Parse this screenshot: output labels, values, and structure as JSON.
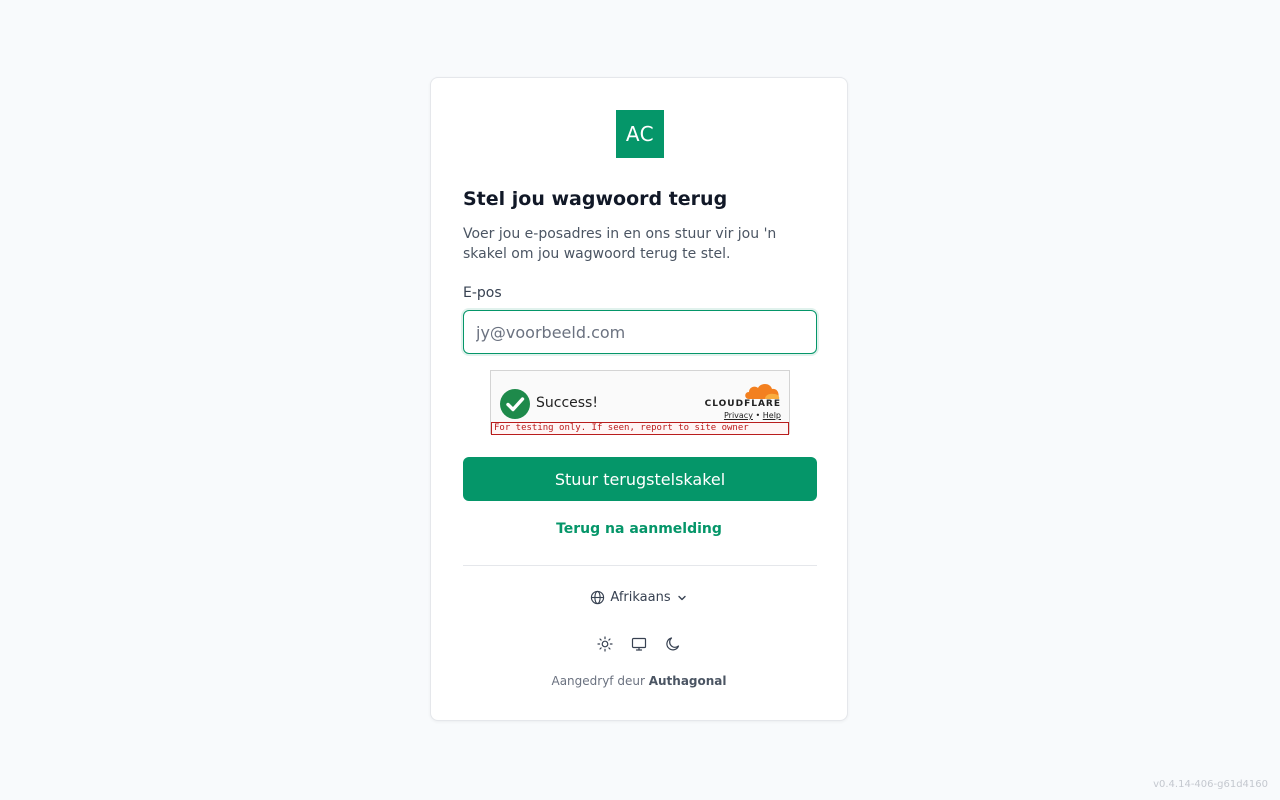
{
  "logo": {
    "text": "AC"
  },
  "page": {
    "title": "Stel jou wagwoord terug",
    "subtitle": "Voer jou e-posadres in en ons stuur vir jou 'n skakel om jou wagwoord terug te stel."
  },
  "form": {
    "email_label": "E-pos",
    "email_value": "",
    "email_placeholder": "jy@voorbeeld.com",
    "submit_label": "Stuur terugstelskakel"
  },
  "captcha": {
    "status_text": "Success!",
    "brand": "CLOUDFLARE",
    "privacy_label": "Privacy",
    "separator": "•",
    "help_label": "Help",
    "warning": "For testing only. If seen, report to site owner",
    "status_icon": "check-circle-icon"
  },
  "links": {
    "back_to_login": "Terug na aanmelding"
  },
  "language": {
    "selected": "Afrikaans",
    "icon": "globe-icon"
  },
  "theme": {
    "options": [
      "light",
      "system",
      "dark"
    ],
    "icons": [
      "sun-icon",
      "monitor-icon",
      "moon-icon"
    ]
  },
  "footer": {
    "powered_prefix": "Aangedryf deur",
    "powered_brand": "Authagonal"
  },
  "version": "v0.4.14-406-g61d4160",
  "colors": {
    "accent": "#059669",
    "background": "#f8fafc",
    "card": "#ffffff",
    "warning": "#b91c1c"
  }
}
